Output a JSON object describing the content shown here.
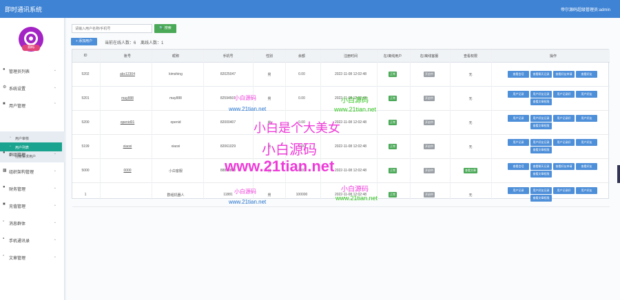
{
  "header": {
    "title": "即时通讯系统",
    "user": "帝尔源码超级管理员:admin"
  },
  "sidebar": {
    "logo_badge": "源码",
    "items": [
      {
        "label": "管理员列表",
        "icon": "user-icon"
      },
      {
        "label": "系统设置",
        "icon": "gear-icon"
      },
      {
        "label": "用户管理",
        "icon": "group-icon"
      },
      {
        "label": "群组管理",
        "icon": "chat-icon"
      },
      {
        "label": "组织架构管理",
        "icon": "org-icon"
      },
      {
        "label": "财务管理",
        "icon": "money-icon"
      },
      {
        "label": "充值管理",
        "icon": "wallet-icon"
      },
      {
        "label": "消息群体",
        "icon": "message-icon"
      },
      {
        "label": "手机通讯录",
        "icon": "phone-icon"
      },
      {
        "label": "文章管理",
        "icon": "doc-icon"
      }
    ],
    "sub_items": [
      {
        "label": "用户审核"
      },
      {
        "label": "用户列表"
      },
      {
        "label": "注册要求用户"
      }
    ]
  },
  "toolbar": {
    "search_placeholder": "请输入用户名称/手机号",
    "search_label": "搜索",
    "add_label": "+ 添加用户"
  },
  "stats": {
    "online": "当前在线人数：6",
    "offline": "离线人数：1"
  },
  "table": {
    "headers": [
      "ID",
      "账号",
      "昵称",
      "手机号",
      "性别",
      "余额",
      "注册时间",
      "在/离线用户",
      "在/离线客服",
      "查看权限",
      "操作"
    ],
    "rows": [
      {
        "id": "5202",
        "account": "abc12304",
        "nickname": "kimshing",
        "phone": "82025047",
        "gender": "男",
        "balance": "0.00",
        "time": "2022-11-08 12:02:48",
        "online": "正常",
        "service": "开启中",
        "perm": "无",
        "actions": [
          "查看会话",
          "查看聊天记录",
          "查看好友申请",
          "查看好友"
        ]
      },
      {
        "id": "5201",
        "account": "may888",
        "nickname": "may888",
        "phone": "82594501",
        "gender": "男",
        "balance": "0.00",
        "time": "2022-11-08 12:02:48",
        "online": "正常",
        "service": "开启中",
        "perm": "无",
        "actions": [
          "用户记录",
          "用户好友记录",
          "用户记录好",
          "用户好友",
          "查看文章权限"
        ]
      },
      {
        "id": "5200",
        "account": "openid01",
        "nickname": "openid",
        "phone": "82000407",
        "gender": "男",
        "balance": "0.00",
        "time": "2022-11-08 12:02:48",
        "online": "正常",
        "service": "开启中",
        "perm": "无",
        "actions": [
          "用户记录",
          "用户好友记录",
          "用户记录好",
          "用户好友",
          "查看文章权限"
        ]
      },
      {
        "id": "5199",
        "account": "xiaoxi",
        "nickname": "xiaoxi",
        "phone": "82061029",
        "gender": "男",
        "balance": "0.00",
        "time": "2022-11-08 12:02:48",
        "online": "正常",
        "service": "开启中",
        "perm": "无",
        "actions": [
          "用户记录",
          "用户好友记录",
          "用户记录好",
          "用户好友",
          "查看文章权限"
        ]
      },
      {
        "id": "5000",
        "account": "0000",
        "nickname": "小白客服",
        "phone": "88888888",
        "gender": "男",
        "balance": "0.00",
        "time": "2022-11-08 12:02:48",
        "online": "正常",
        "service": "开启中",
        "perm": "查看文章",
        "actions": [
          "查看会话",
          "查看聊天记录",
          "查看好友申请",
          "查看好友",
          "查看文章权限"
        ]
      },
      {
        "id": "1",
        "account": "",
        "nickname": "群组机器人",
        "phone": "11881",
        "gender": "男",
        "balance": "100000",
        "time": "2022-11-08 12:02:48",
        "online": "正常",
        "service": "开启中",
        "perm": "无",
        "actions": [
          "用户记录",
          "用户好友记录",
          "用户记录好",
          "用户好友",
          "查看文章权限"
        ]
      }
    ]
  },
  "watermarks": {
    "small_cn": "小白源码",
    "small_url": "www.21tian.net",
    "big_line1": "小白是个大美女",
    "big_line2": "小白源码",
    "big_url": "www.21tian.net"
  },
  "colors": {
    "topbar": "#3f83d4",
    "accent_green": "#4aa957",
    "button_blue": "#4e8fd9",
    "active_menu": "#1aa38f",
    "logo": "#a323c4"
  }
}
